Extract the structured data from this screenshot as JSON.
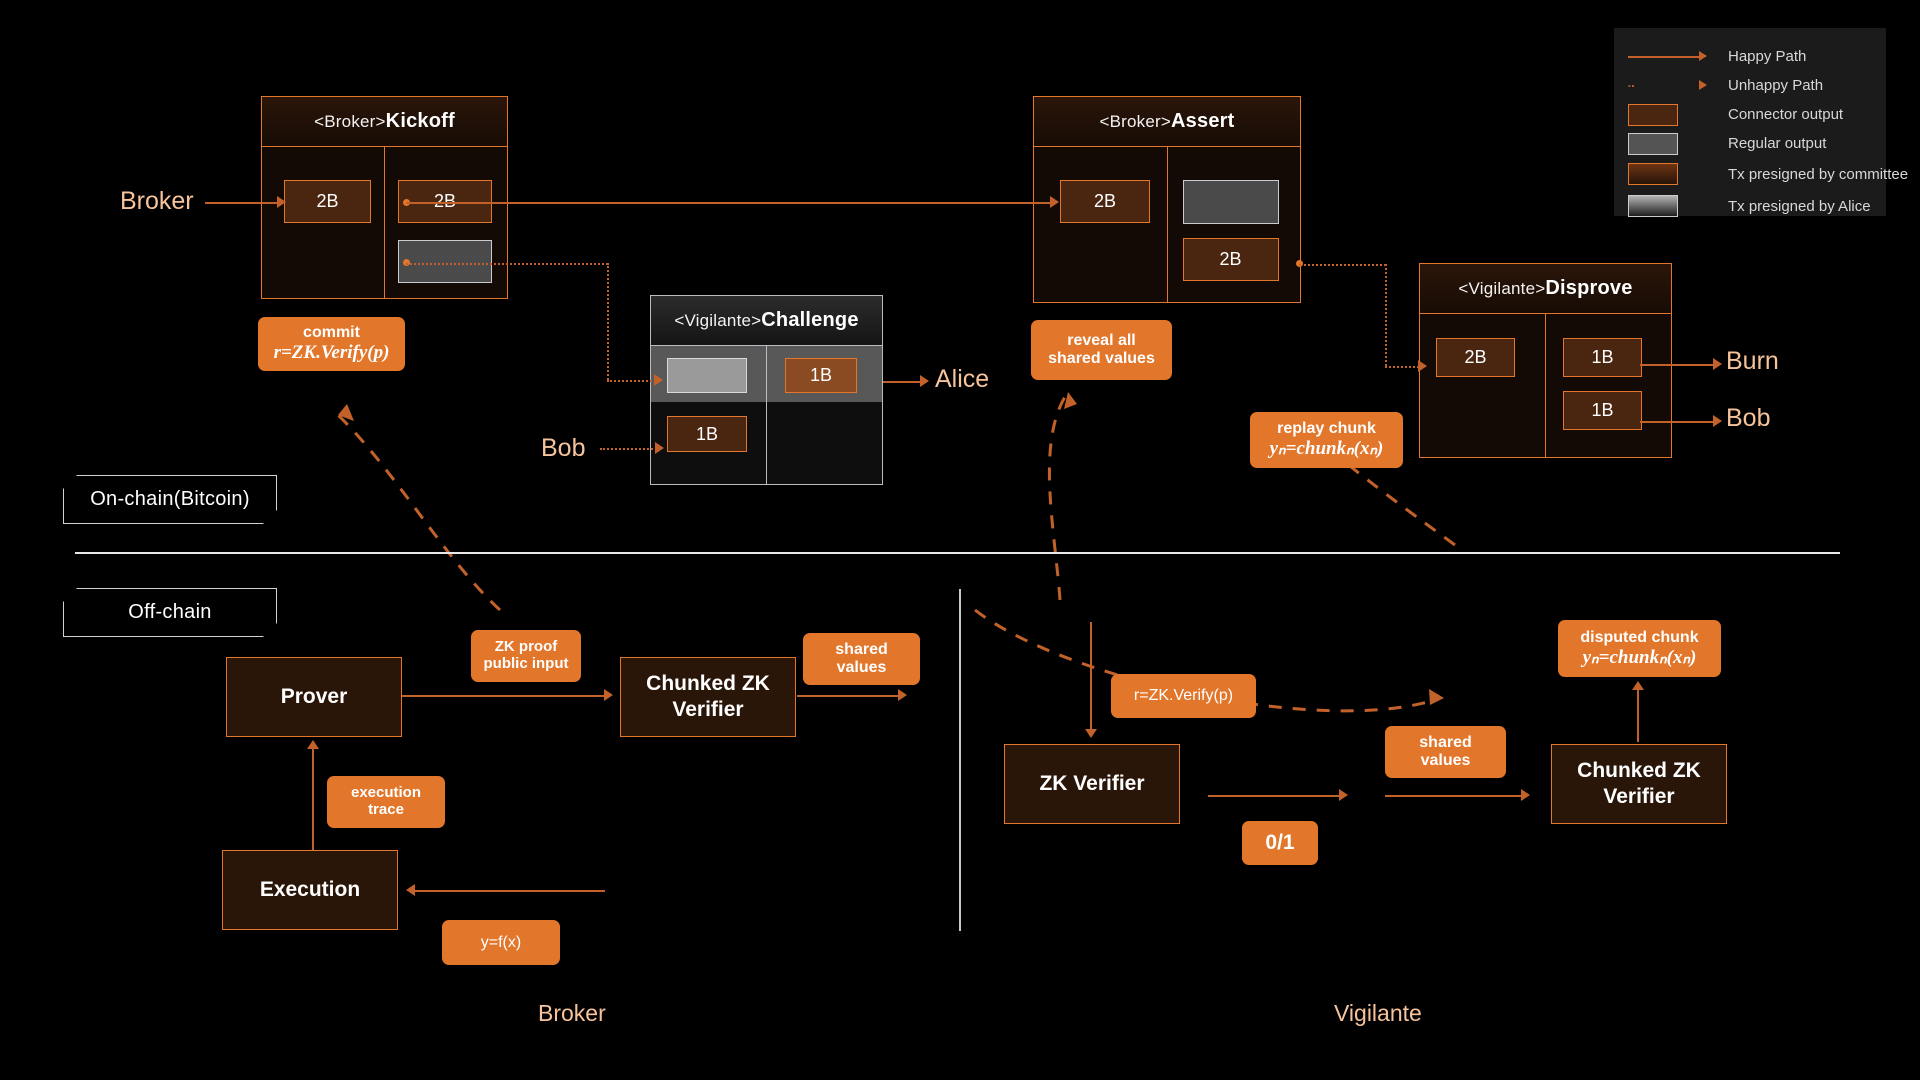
{
  "legend": {
    "items": [
      {
        "key": "happy-path-line",
        "label": "Happy Path"
      },
      {
        "key": "unhappy-path-line",
        "label": "Unhappy Path"
      },
      {
        "key": "connector-output",
        "label": "Connector output"
      },
      {
        "key": "regular-output",
        "label": "Regular output"
      },
      {
        "key": "tx-committee",
        "label": "Tx presigned by committee"
      },
      {
        "key": "tx-alice",
        "label": "Tx presigned by Alice"
      }
    ]
  },
  "colors": {
    "accent": "#e2762a",
    "line": "#c2622a",
    "background": "#000000",
    "tx_fill": "#130a05",
    "connector_fill": "#4a2611",
    "regular_fill": "#4a4a4a",
    "label_text": "#f6c39b",
    "legend_bg": "#1b1b1b"
  },
  "transactions": [
    {
      "id": "broker-kickoff",
      "role": "<Broker>",
      "name": "Kickoff",
      "presigned_by": "committee",
      "inputs": [
        {
          "amount": "2B",
          "type": "connector"
        }
      ],
      "outputs": [
        {
          "amount": "2B",
          "type": "connector"
        },
        {
          "amount": "",
          "type": "regular"
        }
      ]
    },
    {
      "id": "broker-assert",
      "role": "<Broker>",
      "name": "Assert",
      "presigned_by": "committee",
      "inputs": [
        {
          "amount": "2B",
          "type": "connector"
        }
      ],
      "outputs": [
        {
          "amount": "",
          "type": "regular"
        },
        {
          "amount": "2B",
          "type": "connector"
        }
      ]
    },
    {
      "id": "vigilante-challenge",
      "role": "<Vigilante>",
      "name": "Challenge",
      "presigned_by": "alice",
      "inputs": [
        {
          "amount": "",
          "type": "regular"
        },
        {
          "amount": "1B",
          "type": "connector"
        }
      ],
      "outputs": [
        {
          "amount": "1B",
          "type": "connector"
        }
      ]
    },
    {
      "id": "vigilante-disprove",
      "role": "<Vigilante>",
      "name": "Disprove",
      "presigned_by": "committee",
      "inputs": [
        {
          "amount": "2B",
          "type": "connector"
        }
      ],
      "outputs": [
        {
          "amount": "1B",
          "type": "connector"
        },
        {
          "amount": "1B",
          "type": "connector"
        }
      ]
    }
  ],
  "onchain_labels": {
    "broker": "Broker",
    "bob_challenge": "Bob",
    "alice": "Alice",
    "burn": "Burn",
    "bob_disprove": "Bob"
  },
  "chain_pills": {
    "onchain": "On-chain(Bitcoin)",
    "offchain": "Off-chain"
  },
  "onchain_pills": [
    {
      "id": "commit",
      "line1": "commit",
      "line2": "r=ZK.Verify(p)"
    },
    {
      "id": "reveal-all",
      "line1": "reveal all",
      "line2_plain": "shared values"
    },
    {
      "id": "replay-chunk",
      "line1": "replay chunk",
      "line2": "yₙ=chunkₙ(xₙ)"
    }
  ],
  "offchain": {
    "broker_section": {
      "title": "Broker",
      "nodes": [
        {
          "id": "prover",
          "label": "Prover"
        },
        {
          "id": "chunked-zk-verifier",
          "label": "Chunked ZK Verifier"
        },
        {
          "id": "execution",
          "label": "Execution"
        }
      ],
      "pills": [
        {
          "id": "zk-proof-public-input",
          "line1": "ZK proof",
          "line2": "public input"
        },
        {
          "id": "shared-values",
          "line1": "shared",
          "line2": "values"
        },
        {
          "id": "execution-trace",
          "line1": "execution",
          "line2": "trace"
        },
        {
          "id": "y-equals-fx",
          "formula": "y=f(x)"
        }
      ]
    },
    "vigilante_section": {
      "title": "Vigilante",
      "nodes": [
        {
          "id": "zk-verifier",
          "label": "ZK Verifier"
        },
        {
          "id": "chunked-zk-verifier",
          "label": "Chunked ZK Verifier"
        }
      ],
      "pills": [
        {
          "id": "r-equals-zk-verify",
          "formula": "r=ZK.Verify(p)"
        },
        {
          "id": "zero-one",
          "formula": "0/1"
        },
        {
          "id": "shared-values",
          "line1": "shared",
          "line2": "values"
        },
        {
          "id": "disputed-chunk",
          "line1": "disputed chunk",
          "line2": "yₙ=chunkₙ(xₙ)"
        }
      ]
    }
  }
}
